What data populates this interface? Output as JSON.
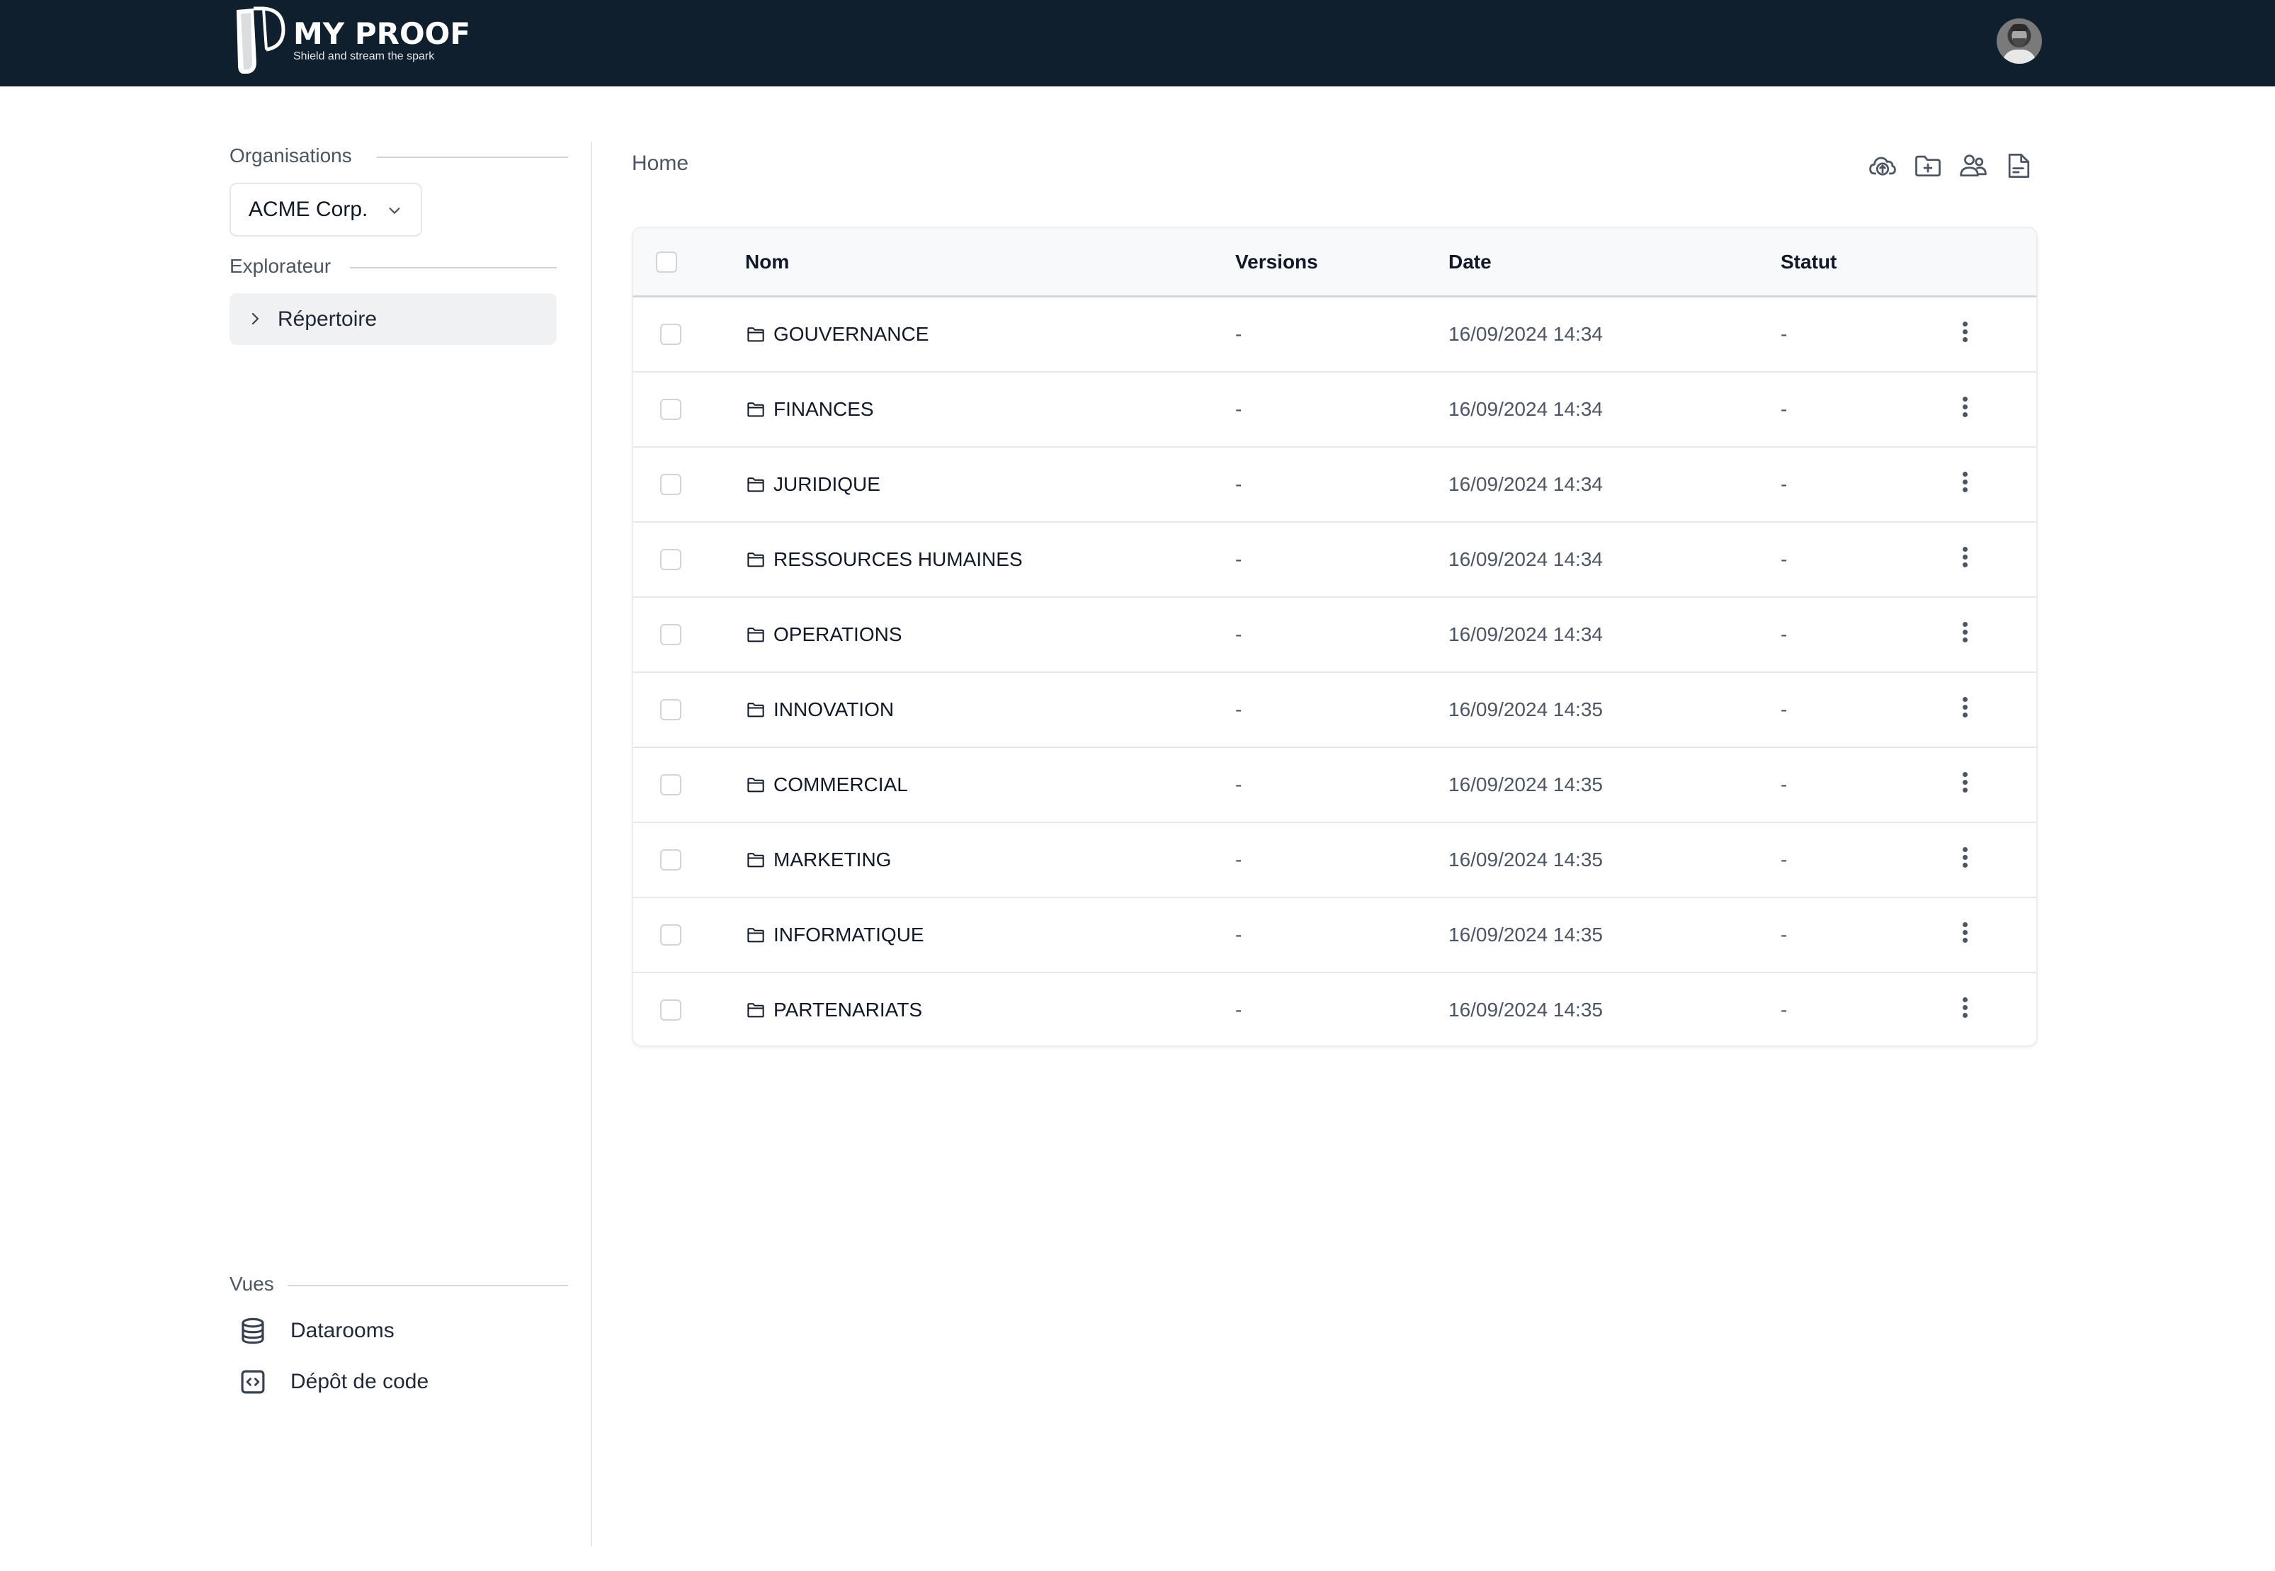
{
  "header": {
    "brand_title": "MY PROOF",
    "brand_tagline": "Shield and stream the spark",
    "colors": {
      "background": "#0f1f2e"
    }
  },
  "sidebar": {
    "organisations_label": "Organisations",
    "org_select_value": "ACME Corp.",
    "explorer_label": "Explorateur",
    "explorer_items": [
      {
        "label": "Répertoire",
        "icon": "chevron-right-icon"
      }
    ],
    "views_label": "Vues",
    "views": [
      {
        "label": "Datarooms",
        "icon": "database-icon"
      },
      {
        "label": "Dépôt de code",
        "icon": "code-icon"
      }
    ]
  },
  "main": {
    "breadcrumb": "Home",
    "toolbar": [
      {
        "name": "upload-cloud-icon",
        "title": "Upload"
      },
      {
        "name": "new-folder-icon",
        "title": "New folder"
      },
      {
        "name": "users-icon",
        "title": "Users"
      },
      {
        "name": "document-icon",
        "title": "Document"
      }
    ],
    "table": {
      "columns": [
        "Nom",
        "Versions",
        "Date",
        "Statut"
      ],
      "rows": [
        {
          "name": "GOUVERNANCE",
          "versions": "-",
          "date": "16/09/2024 14:34",
          "status": "-"
        },
        {
          "name": "FINANCES",
          "versions": "-",
          "date": "16/09/2024 14:34",
          "status": "-"
        },
        {
          "name": "JURIDIQUE",
          "versions": "-",
          "date": "16/09/2024 14:34",
          "status": "-"
        },
        {
          "name": "RESSOURCES HUMAINES",
          "versions": "-",
          "date": "16/09/2024 14:34",
          "status": "-"
        },
        {
          "name": "OPERATIONS",
          "versions": "-",
          "date": "16/09/2024 14:34",
          "status": "-"
        },
        {
          "name": "INNOVATION",
          "versions": "-",
          "date": "16/09/2024 14:35",
          "status": "-"
        },
        {
          "name": "COMMERCIAL",
          "versions": "-",
          "date": "16/09/2024 14:35",
          "status": "-"
        },
        {
          "name": "MARKETING",
          "versions": "-",
          "date": "16/09/2024 14:35",
          "status": "-"
        },
        {
          "name": "INFORMATIQUE",
          "versions": "-",
          "date": "16/09/2024 14:35",
          "status": "-"
        },
        {
          "name": "PARTENARIATS",
          "versions": "-",
          "date": "16/09/2024 14:35",
          "status": "-"
        }
      ]
    }
  }
}
